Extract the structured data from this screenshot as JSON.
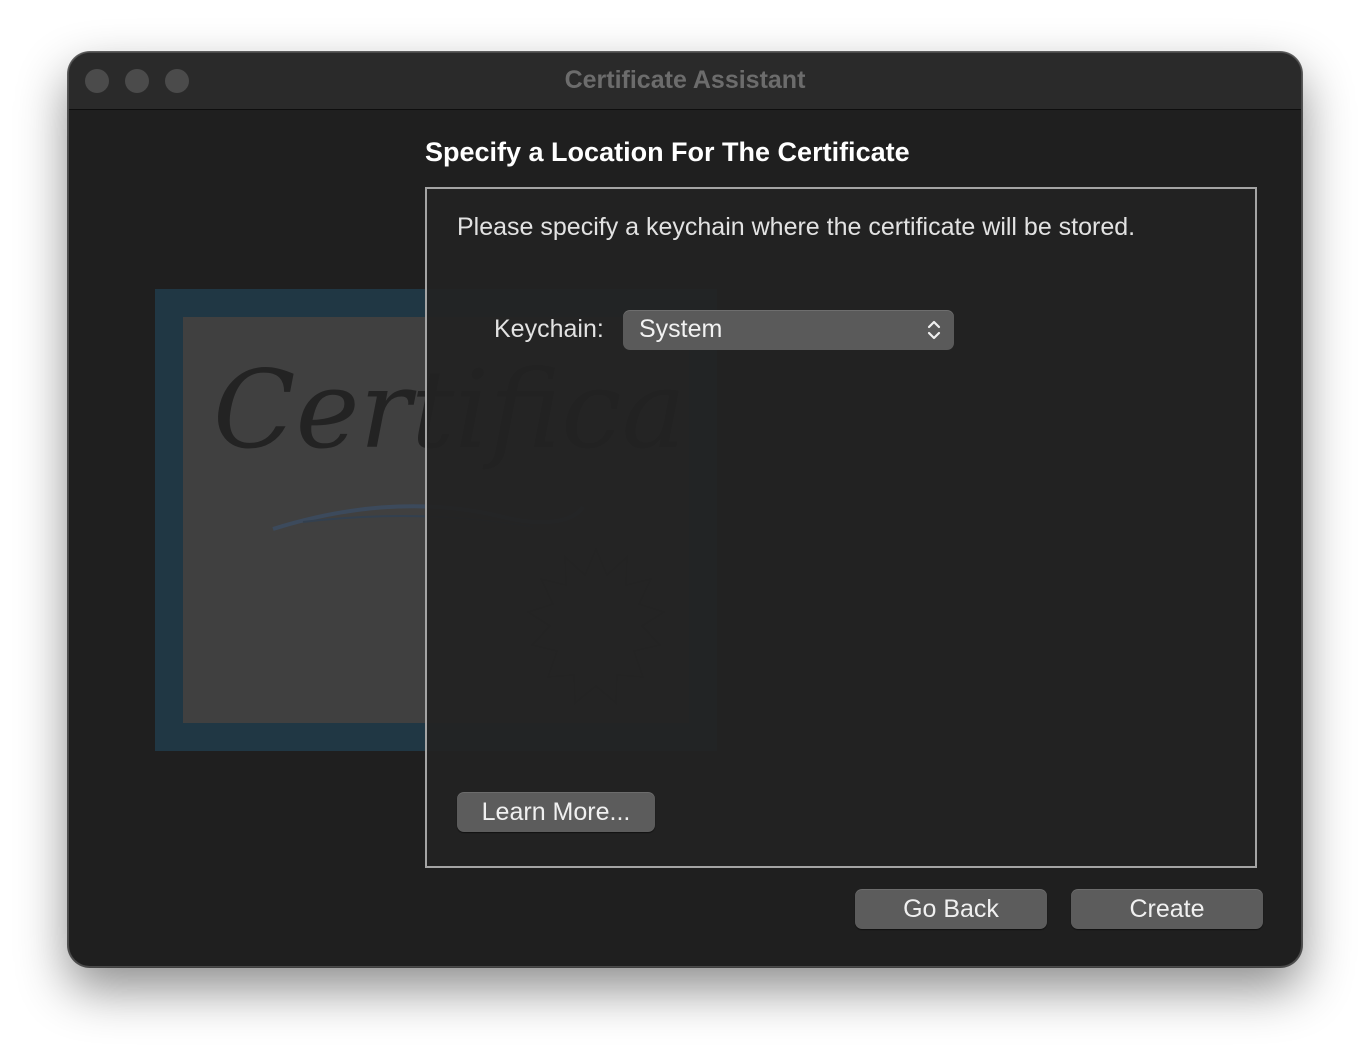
{
  "window": {
    "title": "Certificate Assistant"
  },
  "heading": "Specify a Location For The Certificate",
  "content": {
    "instructions": "Please specify a keychain where the certificate will be stored.",
    "keychain": {
      "label": "Keychain:",
      "selected": "System"
    },
    "learn_more_label": "Learn More..."
  },
  "footer": {
    "go_back_label": "Go Back",
    "create_label": "Create"
  },
  "art": {
    "certificate_script": "Certificate"
  },
  "icons": {
    "window_controls": [
      "close-icon",
      "minimize-icon",
      "zoom-icon"
    ],
    "popup": "chevron-up-down-icon",
    "art_seal": "seal-icon"
  },
  "colors": {
    "window_bg": "#1f1f1f",
    "button_bg": "#5c5c5c",
    "art_border": "#203744"
  }
}
